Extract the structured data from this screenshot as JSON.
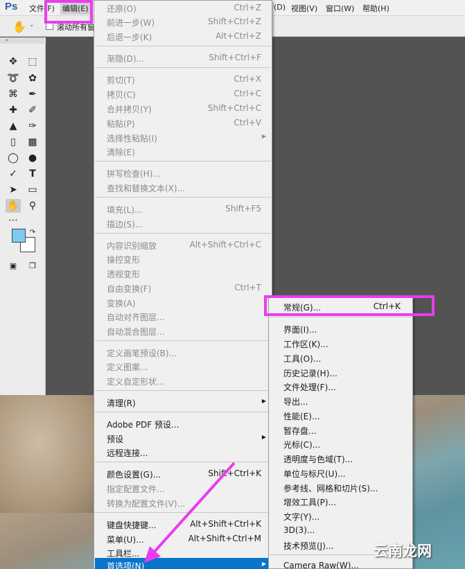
{
  "app": {
    "logo": "Ps"
  },
  "menubar": {
    "file": "文件(F)",
    "edit": "编辑(E)",
    "extra": "(D)",
    "view": "视图(V)",
    "window": "窗口(W)",
    "help": "帮助(H)"
  },
  "options_bar": {
    "scroll_all_label": "滚动所有窗"
  },
  "tools": {
    "icons": [
      "move-icon",
      "marquee-icon",
      "lasso-icon",
      "quick-select-icon",
      "crop-icon",
      "eyedropper-icon",
      "healing-icon",
      "brush-icon",
      "stamp-icon",
      "history-brush-icon",
      "eraser-icon",
      "gradient-icon",
      "blur-icon",
      "dodge-icon",
      "pen-icon",
      "type-icon",
      "path-select-icon",
      "shape-icon",
      "hand-icon",
      "zoom-icon",
      "more-icon"
    ],
    "foreground_color": "#7ecbf1",
    "background_color": "#ffffff"
  },
  "edit_menu": {
    "undo": {
      "label": "还原(O)",
      "shortcut": "Ctrl+Z"
    },
    "step_forward": {
      "label": "前进一步(W)",
      "shortcut": "Shift+Ctrl+Z"
    },
    "step_backward": {
      "label": "后退一步(K)",
      "shortcut": "Alt+Ctrl+Z"
    },
    "fade": {
      "label": "渐隐(D)...",
      "shortcut": "Shift+Ctrl+F"
    },
    "cut": {
      "label": "剪切(T)",
      "shortcut": "Ctrl+X"
    },
    "copy": {
      "label": "拷贝(C)",
      "shortcut": "Ctrl+C"
    },
    "copy_merged": {
      "label": "合并拷贝(Y)",
      "shortcut": "Shift+Ctrl+C"
    },
    "paste": {
      "label": "粘贴(P)",
      "shortcut": "Ctrl+V"
    },
    "paste_special": {
      "label": "选择性粘贴(I)"
    },
    "clear": {
      "label": "清除(E)"
    },
    "check_spelling": {
      "label": "拼写检查(H)..."
    },
    "find_replace": {
      "label": "查找和替换文本(X)..."
    },
    "fill": {
      "label": "填充(L)...",
      "shortcut": "Shift+F5"
    },
    "stroke": {
      "label": "描边(S)..."
    },
    "content_aware_scale": {
      "label": "内容识别缩放",
      "shortcut": "Alt+Shift+Ctrl+C"
    },
    "puppet_warp": {
      "label": "操控变形"
    },
    "perspective_warp": {
      "label": "透视变形"
    },
    "free_transform": {
      "label": "自由变换(F)",
      "shortcut": "Ctrl+T"
    },
    "transform": {
      "label": "变换(A)"
    },
    "auto_align": {
      "label": "自动对齐图层..."
    },
    "auto_blend": {
      "label": "自动混合图层..."
    },
    "define_brush": {
      "label": "定义画笔预设(B)..."
    },
    "define_pattern": {
      "label": "定义图案..."
    },
    "define_shape": {
      "label": "定义自定形状..."
    },
    "purge": {
      "label": "清理(R)"
    },
    "pdf_presets": {
      "label": "Adobe PDF 预设..."
    },
    "presets": {
      "label": "预设"
    },
    "remote_connections": {
      "label": "远程连接..."
    },
    "color_settings": {
      "label": "颜色设置(G)...",
      "shortcut": "Shift+Ctrl+K"
    },
    "assign_profile": {
      "label": "指定配置文件..."
    },
    "convert_profile": {
      "label": "转换为配置文件(V)..."
    },
    "keyboard_shortcuts": {
      "label": "键盘快捷键...",
      "shortcut": "Alt+Shift+Ctrl+K"
    },
    "menus": {
      "label": "菜单(U)...",
      "shortcut": "Alt+Shift+Ctrl+M"
    },
    "toolbar": {
      "label": "工具栏..."
    },
    "preferences": {
      "label": "首选项(N)"
    }
  },
  "preferences_menu": {
    "general": {
      "label": "常规(G)...",
      "shortcut": "Ctrl+K"
    },
    "items": [
      "界面(I)...",
      "工作区(K)...",
      "工具(O)...",
      "历史记录(H)...",
      "文件处理(F)...",
      "导出...",
      "性能(E)...",
      "暂存盘...",
      "光标(C)...",
      "透明度与色域(T)...",
      "单位与标尺(U)...",
      "参考线、网格和切片(S)...",
      "增效工具(P)...",
      "文字(Y)...",
      "3D(3)...",
      "技术预览(J)..."
    ],
    "camera_raw": {
      "label": "Camera Raw(W)..."
    }
  },
  "watermark": "云南龙网",
  "annotation_color": "#e93cf0"
}
